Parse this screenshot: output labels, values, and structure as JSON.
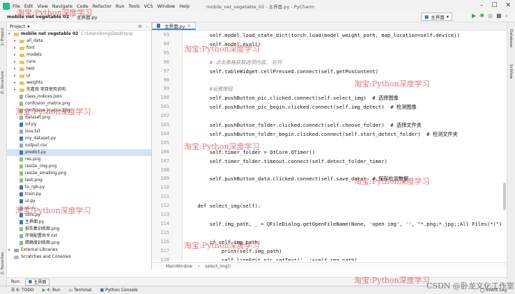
{
  "menubar": {
    "items": [
      "File",
      "Edit",
      "View",
      "Navigate",
      "Code",
      "Refactor",
      "Run",
      "Tools",
      "VCS",
      "Window",
      "Help"
    ],
    "title": "mobile_net_vegetable_02 - 主界面.py - PyCharm"
  },
  "navbar": {
    "project": "mobile net vegetable 02",
    "file": "主界面.py",
    "run_config": "主界面"
  },
  "left_tool_tabs": [
    "1: Project",
    "Z: Structure",
    "2: Favorites"
  ],
  "right_tool_tabs": [
    "Database",
    "SciView"
  ],
  "project_panel": {
    "header": "Project",
    "root": "mobile net vegetable 02",
    "root_path": "C:\\Users\\kong\\Desktop\\p",
    "items": [
      {
        "name": "all_data",
        "kind": "folder"
      },
      {
        "name": "font",
        "kind": "folder"
      },
      {
        "name": "models",
        "kind": "folder"
      },
      {
        "name": "runs",
        "kind": "folder"
      },
      {
        "name": "test",
        "kind": "folder"
      },
      {
        "name": "ui",
        "kind": "folder"
      },
      {
        "name": "weights",
        "kind": "folder"
      },
      {
        "name": "先看我 项目使用说明",
        "kind": "folder"
      },
      {
        "name": "class_indices.json",
        "kind": "file"
      },
      {
        "name": "confusion_matrix.png",
        "kind": "img"
      },
      {
        "name": "confusion_matrix.png",
        "kind": "img"
      },
      {
        "name": "dataset.png",
        "kind": "img"
      },
      {
        "name": "inf.py",
        "kind": "py"
      },
      {
        "name": "loss.txt",
        "kind": "file"
      },
      {
        "name": "my_dataset.py",
        "kind": "py"
      },
      {
        "name": "output.csv",
        "kind": "file"
      },
      {
        "name": "predict.py",
        "kind": "py"
      },
      {
        "name": "res.png",
        "kind": "img"
      },
      {
        "name": "resize_img.png",
        "kind": "img"
      },
      {
        "name": "resize_smalling.png",
        "kind": "img"
      },
      {
        "name": "test.png",
        "kind": "img"
      },
      {
        "name": "to_rgb.py",
        "kind": "py"
      },
      {
        "name": "train.py",
        "kind": "py"
      },
      {
        "name": "ui.py",
        "kind": "py"
      },
      {
        "name": "ui.ui",
        "kind": "file"
      },
      {
        "name": "utils.py",
        "kind": "py"
      },
      {
        "name": "主界面.py",
        "kind": "py"
      },
      {
        "name": "损失集训练图.png",
        "kind": "img"
      },
      {
        "name": "环境配置命令.txt",
        "kind": "file"
      },
      {
        "name": "精确度训练图.png",
        "kind": "img"
      }
    ],
    "external": "External Libraries",
    "scratches": "Scratches and Consoles"
  },
  "editor": {
    "tab": "主界面.py",
    "lines": [
      {
        "n": "93",
        "t": "        self.model.load_state_dict(torch.load(model_weight_path, map_location=self.device))",
        "c": false
      },
      {
        "n": "94",
        "t": "        self.model.eval()",
        "c": false
      },
      {
        "n": "95",
        "t": "",
        "c": false
      },
      {
        "n": "96",
        "t": "        # 点击表格获取选项内容, 右列",
        "c": true
      },
      {
        "n": "97",
        "t": "        self.tableWidget.cellPressed.connect(self.getPosContent)",
        "c": false
      },
      {
        "n": "98",
        "t": "",
        "c": false
      },
      {
        "n": "99",
        "t": "        #设置按钮",
        "c": true
      },
      {
        "n": "100",
        "t": "        self.pushButton_pic.clicked.connect(self.select_img)  # 选择图像",
        "c": false
      },
      {
        "n": "101",
        "t": "        self.pushButton_pic_begin.clicked.connect(self.img_detect)  # 检测图像",
        "c": false
      },
      {
        "n": "102",
        "t": "",
        "c": false
      },
      {
        "n": "103",
        "t": "        self.pushButton_folder.clicked.connect(self.choose_folder)  # 选择文件夹",
        "c": false
      },
      {
        "n": "104",
        "t": "        self.pushButton_folder_begin.clicked.connect(self.start_detect_folder)  # 检测文件夹",
        "c": false
      },
      {
        "n": "105",
        "t": "",
        "c": false
      },
      {
        "n": "106",
        "t": "        self.timer_folder = QtCore.QTimer()",
        "c": false
      },
      {
        "n": "107",
        "t": "        self.timer_folder.timeout.connect(self.detect_folder_timer)",
        "c": false
      },
      {
        "n": "108",
        "t": "",
        "c": false
      },
      {
        "n": "109",
        "t": "        self.pushButton_data.clicked.connect(self.save_data)  # 保存检测数据",
        "c": false
      },
      {
        "n": "110",
        "t": "",
        "c": false
      },
      {
        "n": "111",
        "t": "",
        "c": false
      },
      {
        "n": "112",
        "t": "    def select_img(self):",
        "c": false
      },
      {
        "n": "113",
        "t": "",
        "c": false
      },
      {
        "n": "114",
        "t": "        self.img_path, _ = QFileDialog.getOpenFileName(None, 'open img', '', \"*.png;*.jpg;;All Files(*)\")",
        "c": false
      },
      {
        "n": "115",
        "t": "",
        "c": false
      },
      {
        "n": "116",
        "t": "        if self.img_path:",
        "c": false
      },
      {
        "n": "117",
        "t": "            print(self.img_path)",
        "c": false
      },
      {
        "n": "118",
        "t": "            self.lineEdit_pic.setText('  '+self.img_path)",
        "c": false
      }
    ],
    "breadcrumb": [
      "MainWindow",
      "select_img()"
    ]
  },
  "run_bar": {
    "label": "Run:",
    "tab": "主界面"
  },
  "statusbar": {
    "items": [
      "6: TODO",
      "4: Run",
      "Terminal",
      "Python Console"
    ],
    "event_log": "Event Log"
  },
  "watermarks": [
    {
      "text": "淘宝:Python深度学习"
    },
    {
      "text": "淘宝:Python深度学习"
    },
    {
      "text": "淘宝:Python深度学习"
    },
    {
      "text": "淘宝:Python深度学习"
    },
    {
      "text": "淘宝:Python深度学习"
    },
    {
      "text": "淘宝:Python深度学习"
    },
    {
      "text": "淘宝:Python深度学习"
    },
    {
      "text": "淘宝:Python深度学习"
    },
    {
      "text": "淘宝:Python深度学习"
    },
    {
      "text": "淘宝:Python深度学习"
    }
  ],
  "credit": "CSDN @卧龙文化工作室"
}
